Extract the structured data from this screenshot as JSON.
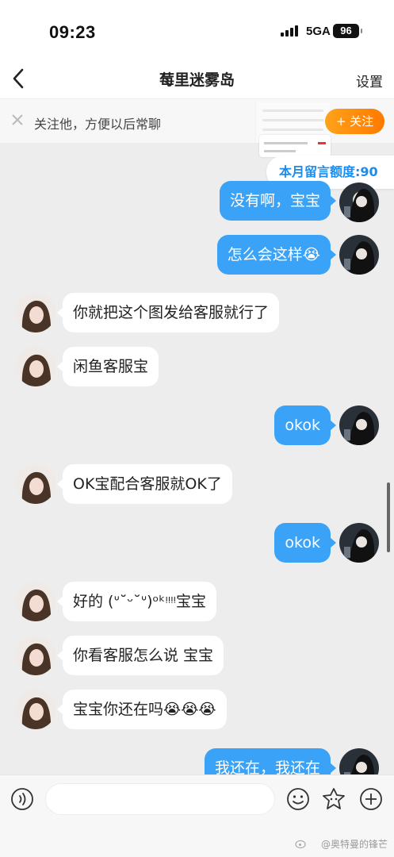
{
  "status": {
    "time": "09:23",
    "network": "5GA",
    "battery": "96"
  },
  "nav": {
    "title": "莓里迷雾岛",
    "settings_label": "设置"
  },
  "follow": {
    "text": "关注他，方便以后常聊",
    "button_label": "+ 关注"
  },
  "quota": {
    "label": "本月留言额度:90"
  },
  "messages": [
    {
      "side": "out",
      "text": "没有啊，宝宝"
    },
    {
      "side": "out",
      "text": "怎么会这样😭"
    },
    {
      "side": "in",
      "text": "你就把这个图发给客服就行了"
    },
    {
      "side": "in",
      "text": "闲鱼客服宝"
    },
    {
      "side": "out",
      "text": "okok"
    },
    {
      "side": "in",
      "text": "OK宝配合客服就OK了"
    },
    {
      "side": "out",
      "text": "okok"
    },
    {
      "side": "in",
      "text": "好的 (ᐡ˘ᵕ˘ᐡ)ᵒᵏᵎᵎᵎᵎ宝宝"
    },
    {
      "side": "in",
      "text": "你看客服怎么说 宝宝"
    },
    {
      "side": "in",
      "text": "宝宝你还在吗😭😭😭"
    },
    {
      "side": "out",
      "text": "我还在，我还在"
    }
  ],
  "input": {
    "placeholder": ""
  },
  "watermark": "@奥特曼的锋芒"
}
